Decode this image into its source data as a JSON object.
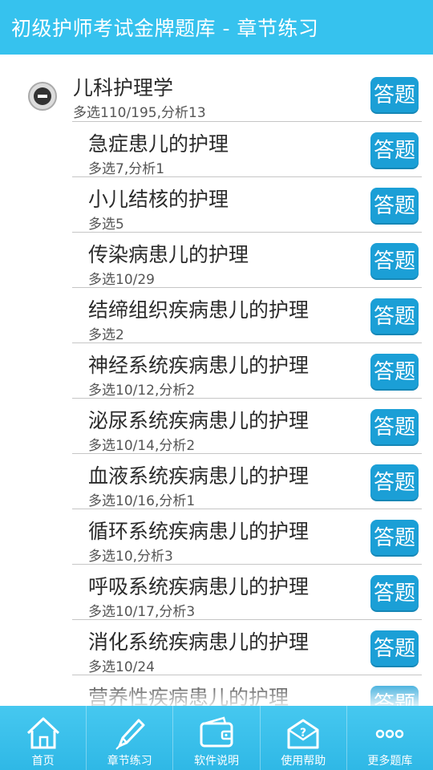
{
  "header": {
    "title": "初级护师考试金牌题库  -  章节练习"
  },
  "answer_label": "答题",
  "parent": {
    "title": "儿科护理学",
    "stats": "多选110/195,分析13"
  },
  "chapters": [
    {
      "title": "急症患儿的护理",
      "stats": "多选7,分析1"
    },
    {
      "title": "小儿结核的护理",
      "stats": "多选5"
    },
    {
      "title": "传染病患儿的护理",
      "stats": "多选10/29"
    },
    {
      "title": "结缔组织疾病患儿的护理",
      "stats": "多选2"
    },
    {
      "title": "神经系统疾病患儿的护理",
      "stats": "多选10/12,分析2"
    },
    {
      "title": "泌尿系统疾病患儿的护理",
      "stats": "多选10/14,分析2"
    },
    {
      "title": "血液系统疾病患儿的护理",
      "stats": "多选10/16,分析1"
    },
    {
      "title": "循环系统疾病患儿的护理",
      "stats": "多选10,分析3"
    },
    {
      "title": "呼吸系统疾病患儿的护理",
      "stats": "多选10/17,分析3"
    },
    {
      "title": "消化系统疾病患儿的护理",
      "stats": "多选10/24"
    },
    {
      "title": "营养性疾病患儿的护理",
      "stats": ""
    }
  ],
  "tabs": [
    {
      "label": "首页",
      "icon": "home-icon"
    },
    {
      "label": "章节练习",
      "icon": "pencil-icon"
    },
    {
      "label": "软件说明",
      "icon": "wallet-icon"
    },
    {
      "label": "使用帮助",
      "icon": "help-envelope-icon"
    },
    {
      "label": "更多题库",
      "icon": "more-icon"
    }
  ]
}
